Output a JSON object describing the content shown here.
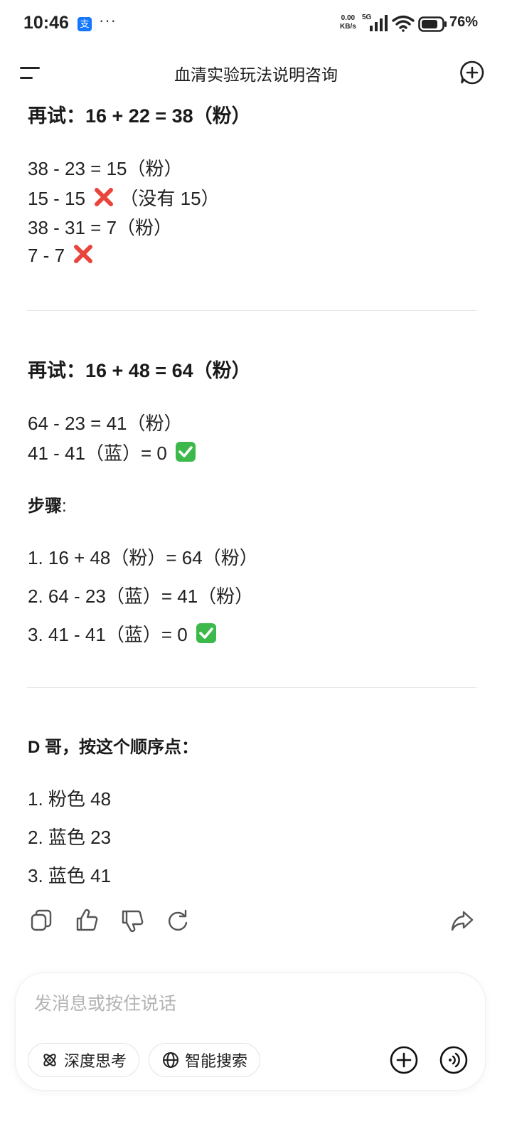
{
  "status_bar": {
    "time": "10:46",
    "app_badge": "支",
    "more": "···",
    "speed_value": "0.00",
    "speed_unit": "KB/s",
    "network": "5G",
    "battery": "76%"
  },
  "header": {
    "title": "血清实验玩法说明咨询"
  },
  "message": {
    "block1": {
      "heading": "再试：16 + 22 = 38（粉）",
      "lines": [
        "38 - 23 = 15（粉）",
        "15 - 15",
        "（没有 15）",
        "38 - 31 = 7（粉）",
        "7 - 7"
      ]
    },
    "block2": {
      "heading": "再试：16 + 48 = 64（粉）",
      "lines": [
        "64 - 23 = 41（粉）",
        "41 - 41（蓝）= 0"
      ]
    },
    "steps_label": "步骤",
    "steps_colon": ":",
    "steps": [
      "1. 16 + 48（粉）= 64（粉）",
      "2. 64 - 23（蓝）= 41（粉）",
      "3. 41 - 41（蓝）= 0"
    ],
    "order_heading": "D 哥，按这个顺序点：",
    "order": [
      "1. 粉色 48",
      "2. 蓝色 23",
      "3. 蓝色 41"
    ]
  },
  "input": {
    "placeholder": "发消息或按住说话",
    "chips": [
      "深度思考",
      "智能搜索"
    ]
  },
  "colors": {
    "cross": "#e8453c",
    "check": "#3cb94a",
    "text": "#1a1a1a",
    "placeholder": "#b3b3b3"
  }
}
